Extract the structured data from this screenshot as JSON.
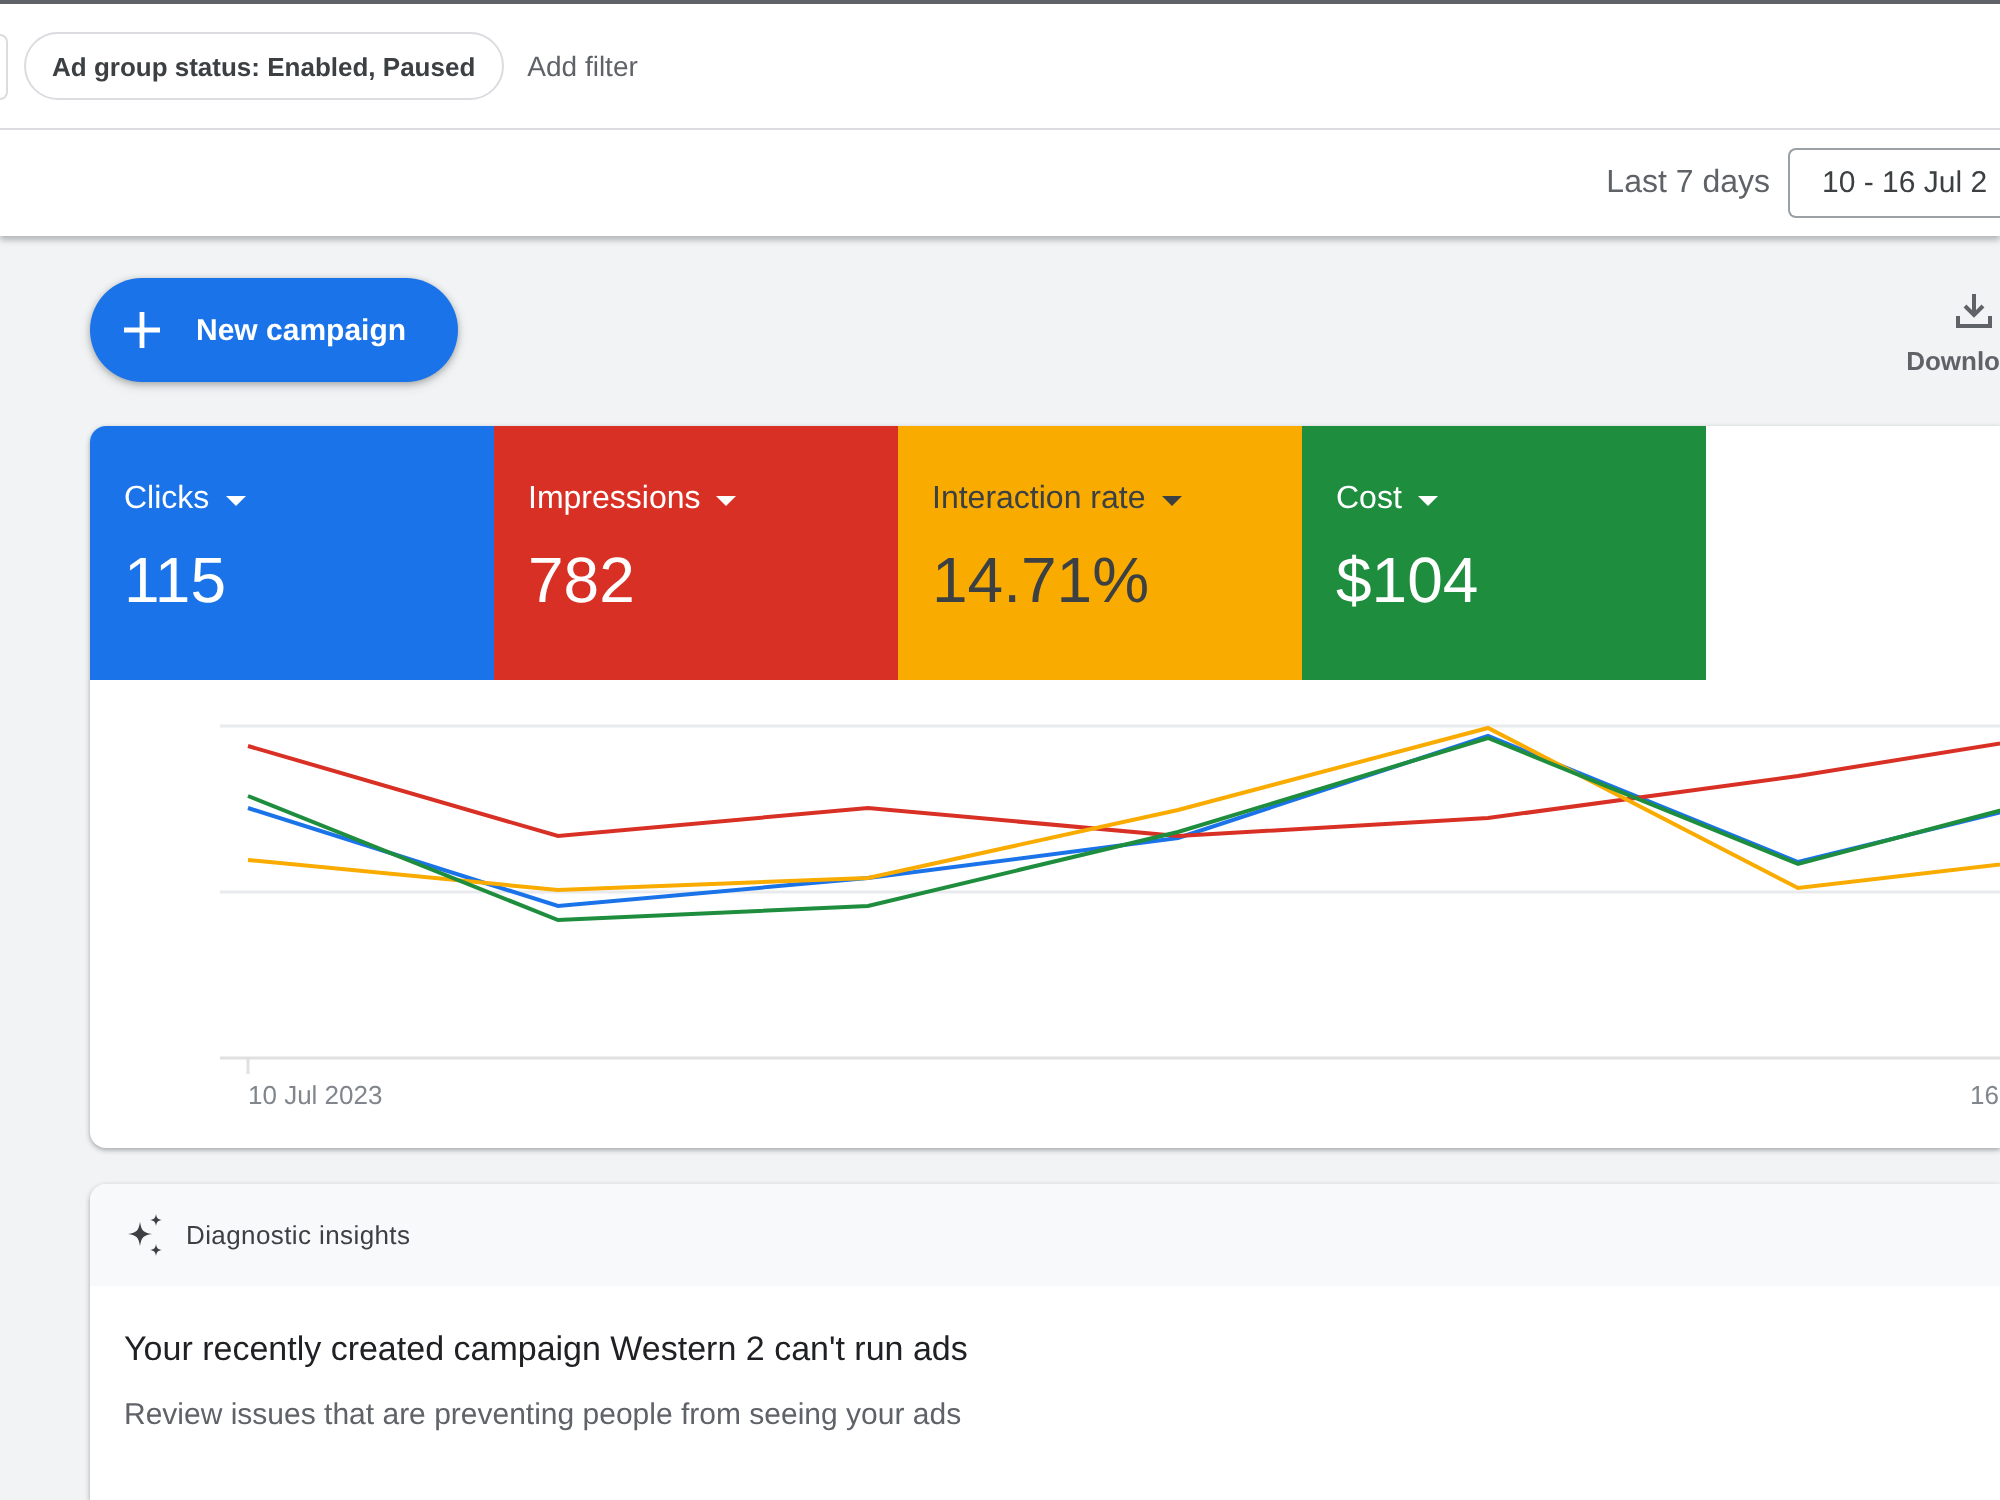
{
  "filters": {
    "chips": [
      {
        "kind": "edge"
      },
      {
        "kind": "full",
        "label": "Ad group status: Enabled, Paused"
      }
    ],
    "add_filter": "Add filter"
  },
  "date_range": {
    "preset": "Last 7 days",
    "value": "10 - 16 Jul 2"
  },
  "toolbar": {
    "new_campaign": "New campaign",
    "download": "Downlo"
  },
  "overview": {
    "metrics": [
      {
        "label": "Clicks",
        "value": "115",
        "color": "#1a73e8",
        "selected": true
      },
      {
        "label": "Impressions",
        "value": "782",
        "color": "#d93025",
        "selected": true
      },
      {
        "label": "Interaction rate",
        "value": "14.71%",
        "color": "#f9ab00",
        "selected": true
      },
      {
        "label": "Cost",
        "value": "$104",
        "color": "#1e8e3e",
        "selected": true
      }
    ],
    "chart": {
      "x_labels": [
        "10 Jul 2023",
        "16"
      ]
    }
  },
  "insights": {
    "header": "Diagnostic insights",
    "title": "Your recently created campaign Western 2 can't run ads",
    "description": "Review issues that are preventing people from seeing your ads"
  }
}
